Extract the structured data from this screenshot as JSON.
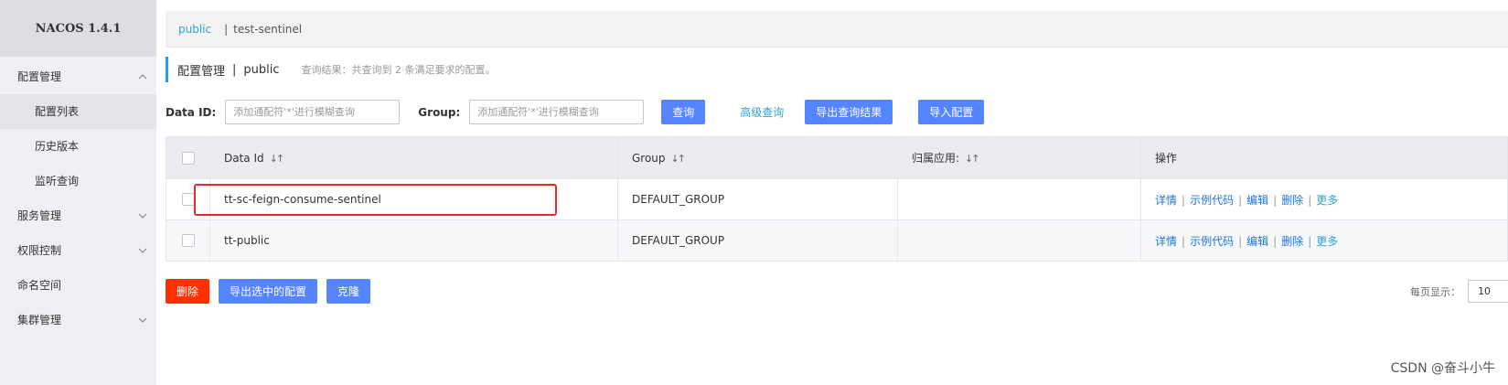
{
  "brand": {
    "title": "NACOS 1.4.1"
  },
  "sidebar": {
    "items": [
      {
        "label": "配置管理",
        "chevron": "up"
      },
      {
        "label": "配置列表"
      },
      {
        "label": "历史版本"
      },
      {
        "label": "监听查询"
      },
      {
        "label": "服务管理",
        "chevron": "down"
      },
      {
        "label": "权限控制",
        "chevron": "down"
      },
      {
        "label": "命名空间"
      },
      {
        "label": "集群管理",
        "chevron": "down"
      }
    ]
  },
  "breadcrumb": {
    "link": "public",
    "separator": "|",
    "current": "test-sentinel"
  },
  "page": {
    "title": "配置管理",
    "separator": "|",
    "namespace": "public",
    "hint": "查询结果：共查询到 2 条满足要求的配置。"
  },
  "search": {
    "dataid_label": "Data ID:",
    "dataid_placeholder": "添加通配符'*'进行模糊查询",
    "group_label": "Group:",
    "group_placeholder": "添加通配符'*'进行模糊查询",
    "query_button": "查询",
    "advanced_button": "高级查询",
    "export_button": "导出查询结果",
    "import_button": "导入配置"
  },
  "table": {
    "headers": [
      "Data Id",
      "Group",
      "归属应用:",
      "操作"
    ],
    "sort_glyph": "↓↑",
    "rows": [
      {
        "data_id": "tt-sc-feign-consume-sentinel",
        "group": "DEFAULT_GROUP",
        "app": ""
      },
      {
        "data_id": "tt-public",
        "group": "DEFAULT_GROUP",
        "app": ""
      }
    ],
    "ops": [
      "详情",
      "示例代码",
      "编辑",
      "删除",
      "更多"
    ],
    "op_sep": "|"
  },
  "bottom": {
    "delete_button": "删除",
    "export_selected_button": "导出选中的配置",
    "clone_button": "克隆",
    "page_size_label": "每页显示：",
    "page_size_value": "10"
  },
  "watermark": "CSDN @奋斗小牛",
  "colors": {
    "primary": "#5584ff",
    "link": "#2ca3d6",
    "danger": "#ff3000",
    "highlight": "#e8292f",
    "accent_bar": "#209bfa"
  }
}
